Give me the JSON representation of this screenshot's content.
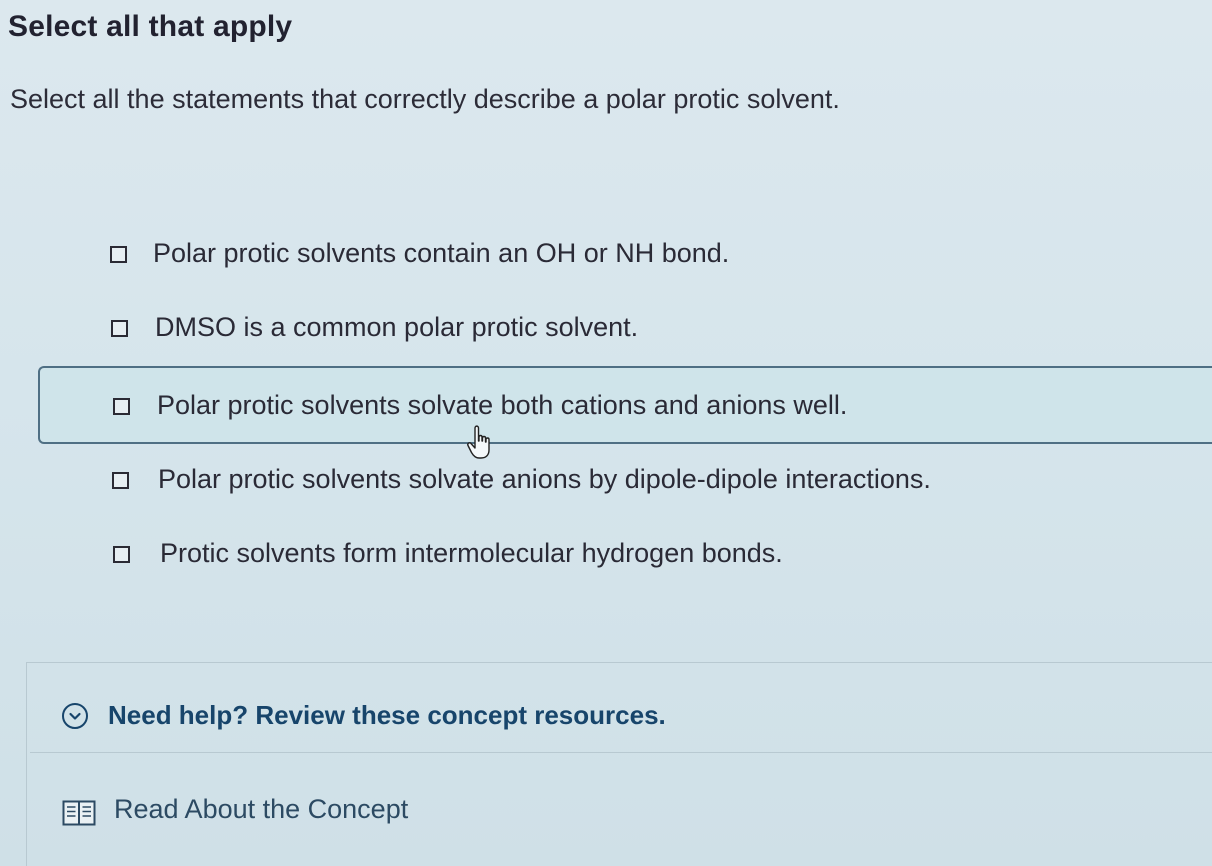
{
  "question": {
    "heading": "Select all that apply",
    "prompt": "Select all the statements that correctly describe a polar protic solvent."
  },
  "choices": [
    {
      "label": "Polar protic solvents contain an OH or NH bond.",
      "checked": false,
      "hovered": false
    },
    {
      "label": "DMSO is a common polar protic solvent.",
      "checked": false,
      "hovered": false
    },
    {
      "label": "Polar protic solvents solvate both cations and anions well.",
      "checked": false,
      "hovered": true
    },
    {
      "label": "Polar protic solvents solvate anions by dipole-dipole interactions.",
      "checked": false,
      "hovered": false
    },
    {
      "label": "Protic solvents form intermolecular hydrogen bonds.",
      "checked": false,
      "hovered": false
    }
  ],
  "help": {
    "toggle_label": "Need help? Review these concept resources.",
    "toggle_icon": "chevron-down-circle-icon",
    "resource_label": "Read About the Concept",
    "resource_icon": "book-icon"
  },
  "colors": {
    "accent": "#17456b",
    "hover_border": "#4f6f84",
    "hover_fill": "#cfe4ea"
  }
}
